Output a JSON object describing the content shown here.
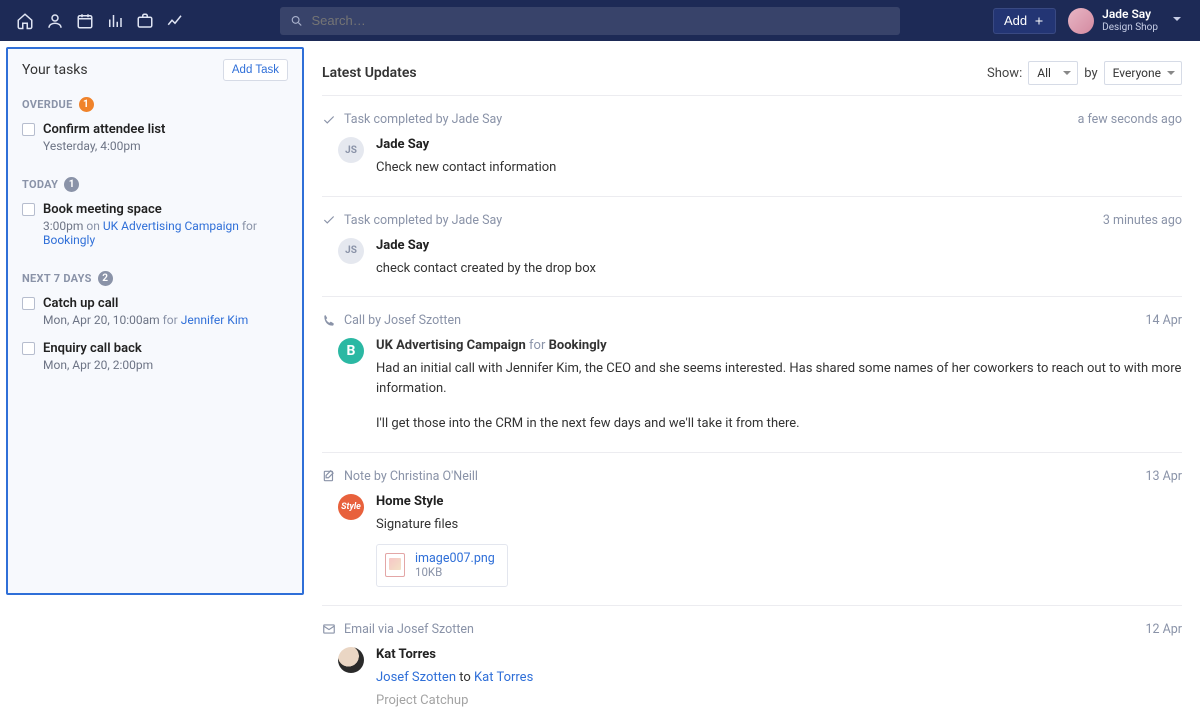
{
  "nav": {
    "search_placeholder": "Search…",
    "add_label": "Add"
  },
  "user": {
    "name": "Jade Say",
    "shop": "Design Shop"
  },
  "sidebar": {
    "title": "Your tasks",
    "add_task_label": "Add Task",
    "sections": {
      "overdue": {
        "label": "OVERDUE",
        "count": "1"
      },
      "today": {
        "label": "TODAY",
        "count": "1"
      },
      "next7": {
        "label": "NEXT 7 DAYS",
        "count": "2"
      }
    },
    "tasks": {
      "overdue_0": {
        "title": "Confirm attendee list",
        "meta": "Yesterday, 4:00pm"
      },
      "today_0": {
        "title": "Book meeting space",
        "time": "3:00pm",
        "on_word": " on ",
        "campaign": "UK Advertising Campaign",
        "for_word": " for ",
        "org": "Bookingly"
      },
      "next7_0": {
        "title": "Catch up call",
        "time_prefix": "Mon, Apr 20, 10:00am",
        "for_word": " for ",
        "person": "Jennifer Kim"
      },
      "next7_1": {
        "title": "Enquiry call back",
        "meta": "Mon, Apr 20, 2:00pm"
      }
    }
  },
  "main": {
    "title": "Latest Updates",
    "show_label": "Show:",
    "by_label": "by",
    "filter_all": "All",
    "filter_everyone": "Everyone"
  },
  "feed": {
    "item0": {
      "head": "Task completed by Jade Say",
      "time": "a few seconds ago",
      "avatar_initials": "JS",
      "author": "Jade Say",
      "text": "Check new contact information"
    },
    "item1": {
      "head": "Task completed by Jade Say",
      "time": "3 minutes ago",
      "avatar_initials": "JS",
      "author": "Jade Say",
      "text": "check contact created by the drop box"
    },
    "item2": {
      "head": "Call by Josef Szotten",
      "time": "14 Apr",
      "avatar_initials": "B",
      "campaign": "UK Advertising Campaign",
      "for_word": " for ",
      "org": "Bookingly",
      "p1": "Had an initial call with Jennifer Kim, the CEO and she seems interested. Has shared some names of her coworkers to reach out to with more information.",
      "p2": "I'll get those into the CRM in the next few days and we'll take it from there."
    },
    "item3": {
      "head": "Note by Christina O'Neill",
      "time": "13 Apr",
      "avatar_label": "Style",
      "author": "Home Style",
      "text": "Signature files",
      "file_name": "image007.png",
      "file_size": "10KB"
    },
    "item4": {
      "head": "Email via Josef Szotten",
      "time": "12 Apr",
      "author": "Kat Torres",
      "from": "Josef Szotten",
      "to_word": " to ",
      "to": "Kat Torres",
      "subject": "Project Catchup"
    }
  }
}
